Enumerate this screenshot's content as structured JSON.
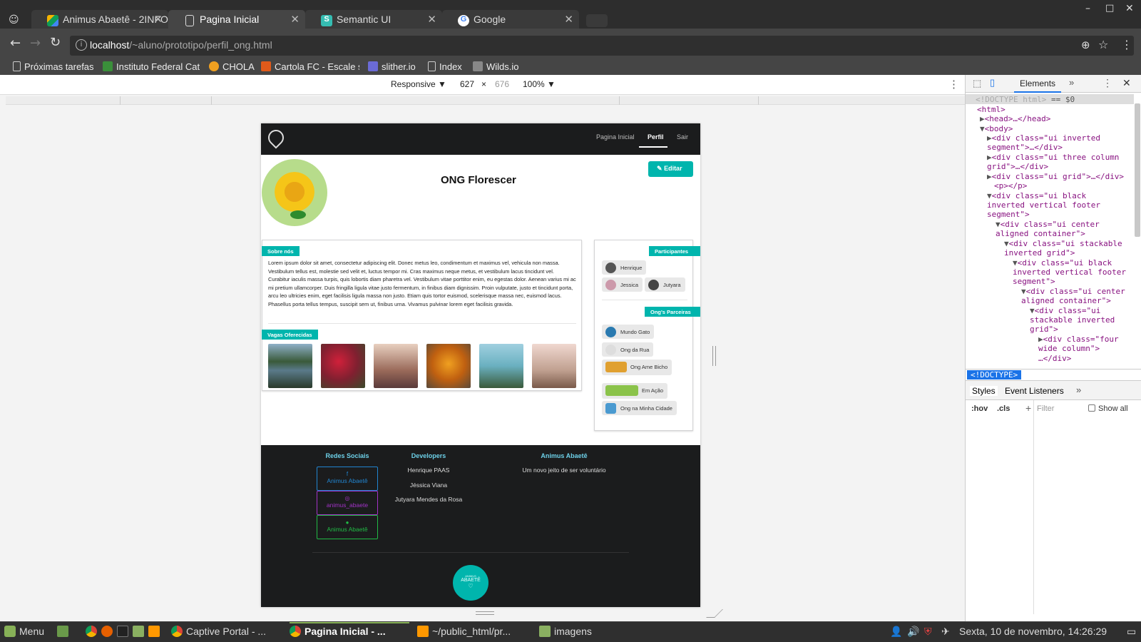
{
  "browser": {
    "tabs": [
      {
        "title": "Animus Abaetê - 2INFO",
        "icon": "google-drive-icon"
      },
      {
        "title": "Pagina Inicial",
        "icon": "page-icon"
      },
      {
        "title": "Semantic UI",
        "icon": "semantic-ui-icon"
      },
      {
        "title": "Google",
        "icon": "google-icon"
      }
    ],
    "url_host": "localhost",
    "url_path": "/~aluno/prototipo/perfil_ong.html",
    "bookmarks": [
      "Próximas tarefas",
      "Instituto Federal Cat",
      "CHOLA",
      "Cartola FC - Escale s",
      "slither.io",
      "Index",
      "Wilds.io"
    ]
  },
  "device_toolbar": {
    "mode": "Responsive",
    "width": "627",
    "times": "×",
    "height": "676",
    "zoom": "100%"
  },
  "site": {
    "nav": {
      "home": "Pagina Inicial",
      "profile": "Perfil",
      "logout": "Sair"
    },
    "org_name": "ONG Florescer",
    "edit_button": "Editar",
    "about_ribbon": "Sobre nós",
    "about_text": "Lorem ipsum dolor sit amet, consectetur adipiscing elit. Donec metus leo, condimentum et maximus vel, vehicula non massa. Vestibulum tellus est, molestie sed velit et, luctus tempor mi. Cras maximus neque metus, et vestibulum lacus tincidunt vel. Curabitur iaculis massa turpis, quis lobortis diam pharetra vel. Vestibulum vitae porttitor enim, eu egestas dolor. Aenean varius mi ac mi pretium ullamcorper. Duis fringilla ligula vitae justo fermentum, in finibus diam dignissim. Proin vulputate, justo et tincidunt porta, arcu leo ultricies enim, eget facilisis ligula massa non justo. Etiam quis tortor euismod, scelerisque massa nec, euismod lacus. Phasellus porta tellus tempus, suscipit sem ut, finibus urna. Vivamus pulvinar lorem eget facilisis gravida.",
    "vacancies_ribbon": "Vagas Oferecidas",
    "participants_ribbon": "Participantes",
    "participants": [
      "Henrique",
      "Jessica",
      "Jutyara"
    ],
    "partners_ribbon": "Ong's Parceiras",
    "partners": [
      "Mundo Gato",
      "Ong da Rua",
      "Ong Ame Bicho",
      "Em Ação",
      "Ong na Minha Cidade"
    ],
    "footer": {
      "social_title": "Redes Sociais",
      "social": [
        "Animus Abaetê",
        "animus_abaete",
        "Animus Abaetê"
      ],
      "dev_title": "Developers",
      "devs": [
        "Henrique PAAS",
        "Jéssica Viana",
        "Jutyara Mendes da Rosa"
      ],
      "brand_title": "Animus Abaetê",
      "brand_slogan": "Um novo jeito de ser voluntário",
      "logo_small": "ANIMUS",
      "logo_big": "ABAETÊ"
    }
  },
  "devtools": {
    "tab_elements": "Elements",
    "doctype_line": "<!DOCTYPE html>",
    "doctype_suffix": " == $0",
    "lines": [
      "<html>",
      "<head>…</head>",
      "<body>",
      "<div class=\"ui inverted",
      "segment\">…</div>",
      "<div class=\"ui three column",
      "grid\">…</div>",
      "<div class=\"ui grid\">…</div>",
      "<p></p>",
      "<div class=\"ui black",
      "inverted vertical footer",
      "segment\">",
      "<div class=\"ui center",
      "aligned container\">",
      "<div class=\"ui stackable",
      "inverted grid\">",
      "<div class=\"ui black",
      "inverted vertical footer",
      "segment\">",
      "<div class=\"ui center",
      "aligned container\">",
      "<div class=\"ui",
      "stackable inverted",
      "grid\">",
      "<div class=\"four",
      "wide column\">",
      "…</div>"
    ],
    "breadcrumb": "<!DOCTYPE>",
    "tab_styles": "Styles",
    "tab_listeners": "Event Listeners",
    "hov": ":hov",
    "cls": ".cls",
    "filter_placeholder": "Filter",
    "show_all": "Show all"
  },
  "taskbar": {
    "menu": "Menu",
    "windows": [
      "Captive Portal - ...",
      "Pagina Inicial - ...",
      "~/public_html/pr...",
      "imagens"
    ],
    "clock": "Sexta, 10 de novembro, 14:26:29"
  },
  "colors": {
    "teal": "#00b5ad",
    "dark": "#1b1c1d",
    "chrome_dark": "#2d2d2d"
  }
}
